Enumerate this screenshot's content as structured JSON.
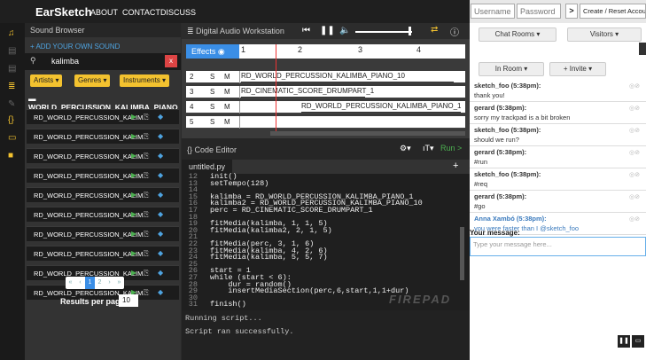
{
  "app": {
    "logo": "EarSketch",
    "nav": [
      "ABOUT",
      "CONTACT",
      "DISCUSS"
    ]
  },
  "auth": {
    "username_placeholder": "Username",
    "password_placeholder": "Password",
    "go_label": ">",
    "create_label": "Create / Reset Account"
  },
  "sound_browser": {
    "title": "Sound Browser",
    "add_label": "ADD YOUR OWN SOUND",
    "search_value": "kalimba",
    "filters": [
      "Artists ▾",
      "Genres ▾",
      "Instruments ▾"
    ],
    "folder": "WORLD_PERCUSSION_KALIMBA_PIANO",
    "items": [
      "RD_WORLD_PERCUSSION_KALIM...",
      "RD_WORLD_PERCUSSION_KALIM...",
      "RD_WORLD_PERCUSSION_KALIM...",
      "RD_WORLD_PERCUSSION_KALIM...",
      "RD_WORLD_PERCUSSION_KALIM...",
      "RD_WORLD_PERCUSSION_KALIM...",
      "RD_WORLD_PERCUSSION_KALIM...",
      "RD_WORLD_PERCUSSION_KALIM...",
      "RD_WORLD_PERCUSSION_KALIM...",
      "RD_WORLD_PERCUSSION_KALIM..."
    ],
    "pages": [
      "«",
      "‹",
      "1",
      "2",
      "›",
      "»"
    ],
    "results_label": "Results per page:",
    "results_value": "10"
  },
  "daw": {
    "title": "Digital Audio Workstation",
    "effects_label": "Effects",
    "measures": [
      "1",
      "2",
      "3",
      "4"
    ],
    "tracks": [
      {
        "num": "2",
        "clip": "RD_WORLD_PERCUSSION_KALIMBA_PIANO_10"
      },
      {
        "num": "3",
        "clip": "RD_CINEMATIC_SCORE_DRUMPART_1"
      },
      {
        "num": "4",
        "clip": "RD_WORLD_PERCUSSION_KALIMBA_PIANO_1"
      },
      {
        "num": "5",
        "clip": ""
      }
    ],
    "solo": "S",
    "mute": "M"
  },
  "editor": {
    "title": "Code Editor",
    "tab": "untitled.py",
    "run_label": "Run >",
    "lines": [
      {
        "n": "12",
        "c": "init()"
      },
      {
        "n": "13",
        "c": "setTempo(128)"
      },
      {
        "n": "14",
        "c": ""
      },
      {
        "n": "15",
        "c": "kalimba = RD_WORLD_PERCUSSION_KALIMBA_PIANO_1"
      },
      {
        "n": "16",
        "c": "kalimba2 = RD_WORLD_PERCUSSION_KALIMBA_PIANO_10"
      },
      {
        "n": "17",
        "c": "perc = RD_CINEMATIC_SCORE_DRUMPART_1"
      },
      {
        "n": "18",
        "c": ""
      },
      {
        "n": "19",
        "c": "fitMedia(kalimba, 1, 1, 5)"
      },
      {
        "n": "20",
        "c": "fitMedia(kalimba2, 2, 1, 5)"
      },
      {
        "n": "21",
        "c": ""
      },
      {
        "n": "22",
        "c": "fitMedia(perc, 3, 1, 6)"
      },
      {
        "n": "23",
        "c": "fitMedia(kalimba, 4, 2, 6)"
      },
      {
        "n": "24",
        "c": "fitMedia(kalimba, 5, 5, 7)"
      },
      {
        "n": "25",
        "c": ""
      },
      {
        "n": "26",
        "c": "start = 1"
      },
      {
        "n": "27",
        "c": "while (start < 6):"
      },
      {
        "n": "28",
        "c": "    dur = random()"
      },
      {
        "n": "29",
        "c": "    insertMediaSection(perc,6,start,1,1+dur)"
      },
      {
        "n": "30",
        "c": ""
      },
      {
        "n": "31",
        "c": "finish()"
      }
    ],
    "watermark": "FIREPAD"
  },
  "console": {
    "lines": [
      "Running script...",
      "Script ran successfully."
    ]
  },
  "chat": {
    "rooms_label": "Chat Rooms ▾",
    "visitors_label": "Visitors ▾",
    "in_room_label": "In Room ▾",
    "invite_label": "+ Invite ▾",
    "messages": [
      {
        "user": "sketch_foo (5:38pm):",
        "text": "thank you!"
      },
      {
        "user": "gerard (5:38pm):",
        "text": "sorry my trackpad is a bit broken"
      },
      {
        "user": "sketch_foo (5:38pm):",
        "text": "should we run?"
      },
      {
        "user": "gerard (5:38pm):",
        "text": "#run"
      },
      {
        "user": "sketch_foo (5:38pm):",
        "text": "#req"
      },
      {
        "user": "gerard (5:38pm):",
        "text": "#go"
      },
      {
        "user": "Anna Xambó (5:38pm):",
        "text": "you were faster than I @sketch_foo"
      }
    ],
    "your_message_label": "Your message:",
    "message_placeholder": "Type your message here..."
  }
}
